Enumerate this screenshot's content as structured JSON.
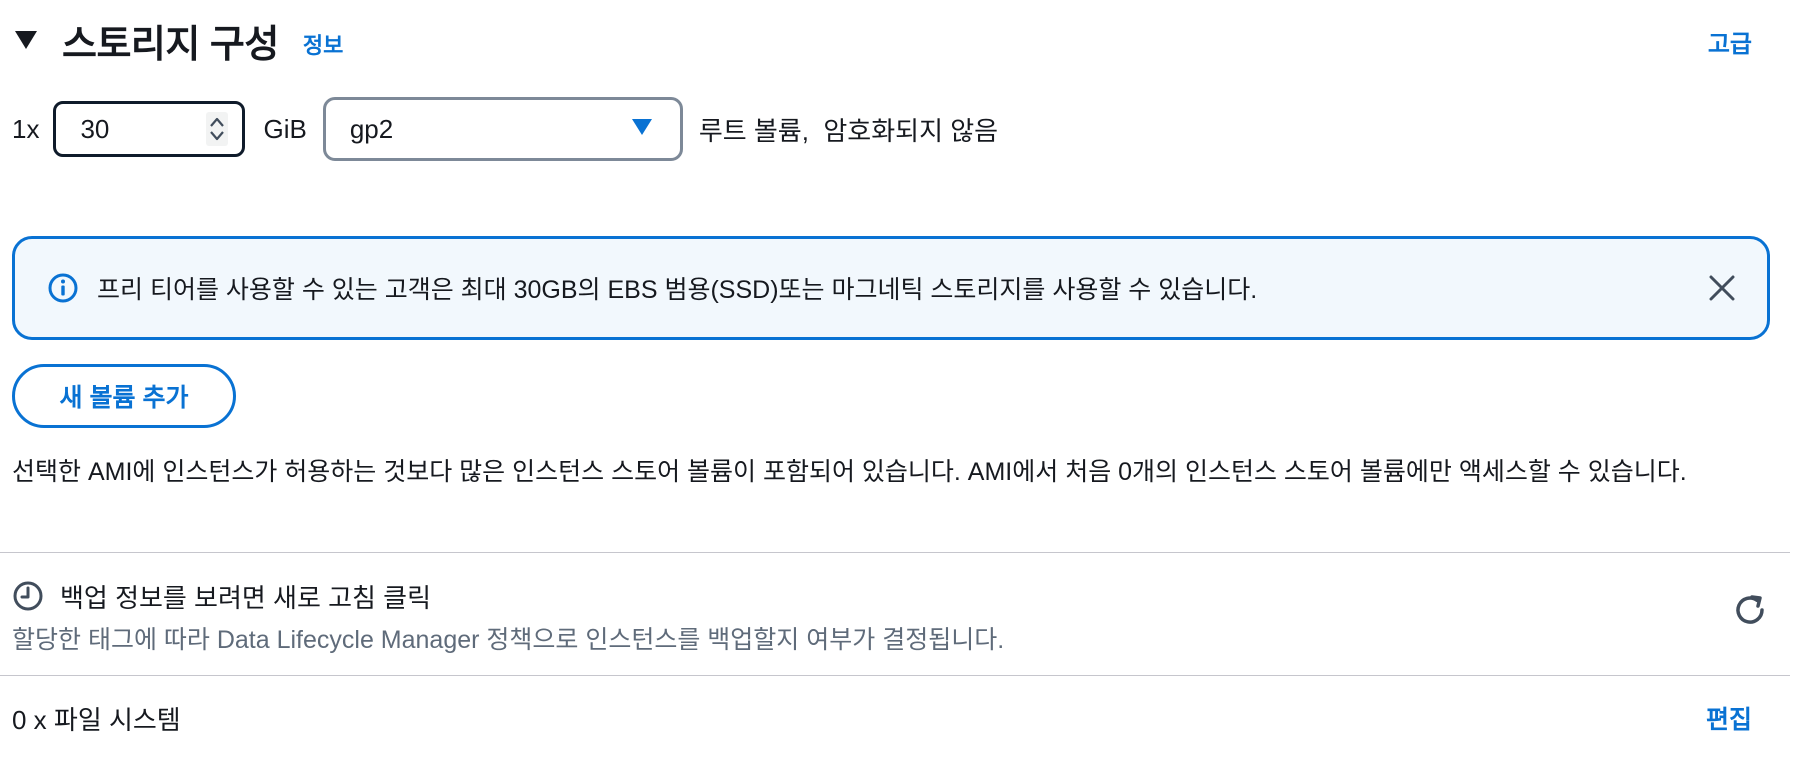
{
  "section": {
    "title": "스토리지 구성",
    "info_link": "정보",
    "advanced_link": "고급"
  },
  "volume": {
    "multiplier": "1x",
    "size_value": "30",
    "unit": "GiB",
    "type_value": "gp2",
    "description": "루트 볼륨,  암호화되지 않음"
  },
  "alert": {
    "text": "프리 티어를 사용할 수 있는 고객은 최대 30GB의 EBS 범용(SSD)또는 마그네틱 스토리지를 사용할 수 있습니다."
  },
  "add_volume_button": "새 볼륨 추가",
  "ami_warning": "선택한 AMI에 인스턴스가 허용하는 것보다 많은 인스턴스 스토어 볼륨이 포함되어 있습니다. AMI에서 처음 0개의 인스턴스 스토어 볼륨에만 액세스할 수 있습니다.",
  "backup": {
    "title": "백업 정보를 보려면 새로 고침 클릭",
    "subtitle": "할당한 태그에 따라 Data Lifecycle Manager 정책으로 인스턴스를 백업할지 여부가 결정됩니다."
  },
  "file_systems": {
    "label": "0 x 파일 시스템",
    "edit_link": "편집"
  },
  "colors": {
    "link": "#0972d3",
    "text": "#16191f",
    "secondary_text": "#5f6b7a",
    "alert_bg": "#f2f8fd",
    "divider": "#c6c6cd"
  },
  "icons": {
    "collapse": "caret-down-icon",
    "stepper": "stepper-icon",
    "select": "caret-down-icon",
    "alert": "info-icon",
    "close": "close-icon",
    "backup": "clock-icon",
    "refresh": "refresh-icon"
  }
}
